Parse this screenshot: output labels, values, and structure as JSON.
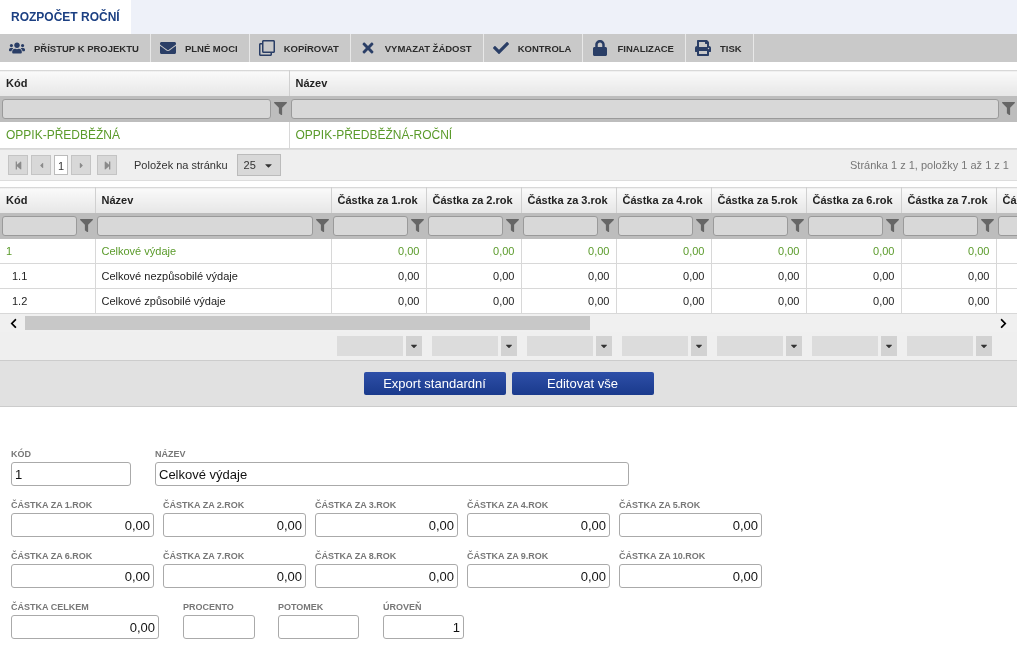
{
  "tabs": [
    {
      "label": "ROZPOČET ROČNÍ",
      "selected": true
    }
  ],
  "toolbar": [
    "PŘÍSTUP K PROJEKTU",
    "PLNÉ MOCI",
    "KOPÍROVAT",
    "VYMAZAT ŽÁDOST",
    "KONTROLA",
    "FINALIZACE",
    "TISK"
  ],
  "top_grid": {
    "columns": [
      "Kód",
      "Název"
    ],
    "rows": [
      {
        "cells": [
          "OPPIK-PŘEDBĚŽNÁ",
          "OPPIK-PŘEDBĚŽNÁ-ROČNÍ"
        ],
        "selected": true
      }
    ],
    "pager": {
      "page": "1",
      "page_size_label": "Položek na stránku",
      "page_size": "25",
      "summary": "Stránka 1 z 1, položky 1 až 1 z 1"
    }
  },
  "main_grid": {
    "columns": [
      "Kód",
      "Název",
      "Částka za 1.rok",
      "Částka za 2.rok",
      "Částka za 3.rok",
      "Částka za 4.rok",
      "Částka za 5.rok",
      "Částka za 6.rok",
      "Částka za 7.rok",
      "Čá"
    ],
    "rows": [
      {
        "code": "1",
        "name": "Celkové výdaje",
        "values": [
          "0,00",
          "0,00",
          "0,00",
          "0,00",
          "0,00",
          "0,00",
          "0,00"
        ],
        "selected": true,
        "children": [
          {
            "code": "1.1",
            "name": "Celkové nezpůsobilé výdaje",
            "values": [
              "0,00",
              "0,00",
              "0,00",
              "0,00",
              "0,00",
              "0,00",
              "0,00"
            ],
            "selected": false
          },
          {
            "code": "1.2",
            "name": "Celkové způsobilé výdaje",
            "values": [
              "0,00",
              "0,00",
              "0,00",
              "0,00",
              "0,00",
              "0,00",
              "0,00"
            ],
            "selected": false
          }
        ]
      }
    ]
  },
  "buttons": [
    "Export standardní",
    "Editovat vše"
  ],
  "form": {
    "fields": [
      {
        "label": "KÓD",
        "value": "1",
        "kind": "text"
      },
      {
        "label": "NÁZEV",
        "value": "Celkové výdaje",
        "kind": "text"
      },
      {
        "label": "ČÁSTKA ZA 1.ROK",
        "value": "0,00",
        "kind": "number"
      },
      {
        "label": "ČÁSTKA ZA 2.ROK",
        "value": "0,00",
        "kind": "number"
      },
      {
        "label": "ČÁSTKA ZA 3.ROK",
        "value": "0,00",
        "kind": "number"
      },
      {
        "label": "ČÁSTKA ZA 4.ROK",
        "value": "0,00",
        "kind": "number"
      },
      {
        "label": "ČÁSTKA ZA 5.ROK",
        "value": "0,00",
        "kind": "number"
      },
      {
        "label": "ČÁSTKA ZA 6.ROK",
        "value": "0,00",
        "kind": "number"
      },
      {
        "label": "ČÁSTKA ZA 7.ROK",
        "value": "0,00",
        "kind": "number"
      },
      {
        "label": "ČÁSTKA ZA 8.ROK",
        "value": "0,00",
        "kind": "number"
      },
      {
        "label": "ČÁSTKA ZA 9.ROK",
        "value": "0,00",
        "kind": "number"
      },
      {
        "label": "ČÁSTKA ZA 10.ROK",
        "value": "0,00",
        "kind": "number"
      },
      {
        "label": "ČÁSTKA CELKEM",
        "value": "0,00",
        "kind": "number"
      },
      {
        "label": "PROCENTO",
        "kind": "number"
      },
      {
        "label": "POTOMEK",
        "kind": "number"
      },
      {
        "label": "ÚROVEŇ",
        "value": "1",
        "kind": "number"
      }
    ]
  }
}
